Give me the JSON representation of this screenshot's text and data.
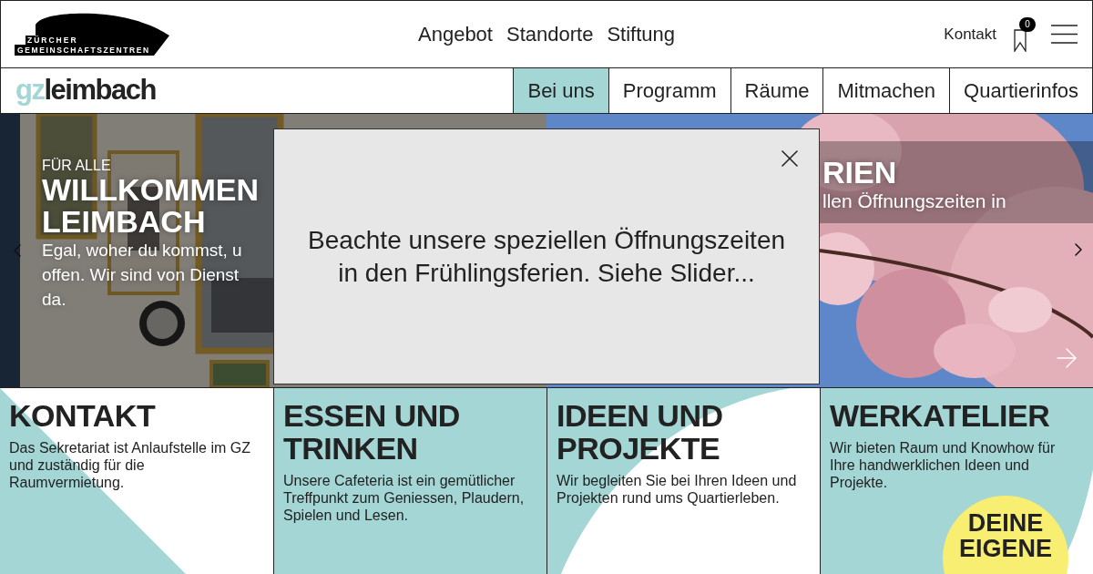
{
  "header": {
    "logo_lines": [
      "ZÜRCHER",
      "GEMEINSCHAFTSZENTREN"
    ],
    "nav": [
      "Angebot",
      "Standorte",
      "Stiftung"
    ],
    "contact_link": "Kontakt",
    "bookmark_count": "0"
  },
  "subheader": {
    "brand_prefix": "gz",
    "brand_name": "leimbach",
    "tabs": [
      {
        "label": "Bei uns",
        "selected": true
      },
      {
        "label": "Programm",
        "selected": false
      },
      {
        "label": "Räume",
        "selected": false
      },
      {
        "label": "Mitmachen",
        "selected": false
      },
      {
        "label": "Quartierinfos",
        "selected": false
      }
    ]
  },
  "slider": {
    "slides": [
      {
        "kind": "interior",
        "kicker": "FÜR ALLE",
        "title_lines": [
          "WILLKOMMEN",
          "LEIMBACH"
        ],
        "text_lines": [
          "Egal, woher du kommst, u",
          "offen. Wir sind von Dienst",
          "da."
        ]
      },
      {
        "kind": "blossom",
        "title_lines": [
          "RIEN"
        ],
        "text_lines": [
          "llen Öffnungszeiten in"
        ]
      }
    ]
  },
  "popup": {
    "lines": [
      "Beachte unsere speziellen Öffnungszeiten",
      "in den Frühlingsferien. Siehe Slider..."
    ]
  },
  "cards": [
    {
      "kind": "triangle",
      "title": "KONTAKT",
      "text": "Das Sekretariat ist Anlaufstelle im GZ und zuständig für die Raumvermietung."
    },
    {
      "kind": "plain",
      "title": "ESSEN UND TRINKEN",
      "text": "Unsere Cafeteria ist ein gemütlicher Treffpunkt zum Geniessen, Plaudern, Spielen und Lesen."
    },
    {
      "kind": "curve",
      "title": "IDEEN UND PROJEKTE",
      "text": "Wir begleiten Sie bei Ihren Ideen und Projekten rund ums Quartierleben."
    },
    {
      "kind": "corner",
      "title": "WERKATELIER",
      "text": "Wir bieten Raum und Knowhow für Ihre handwerklichen Ideen und Projekte.",
      "badge_lines": [
        "DEINE",
        "EIGENE"
      ]
    }
  ]
}
